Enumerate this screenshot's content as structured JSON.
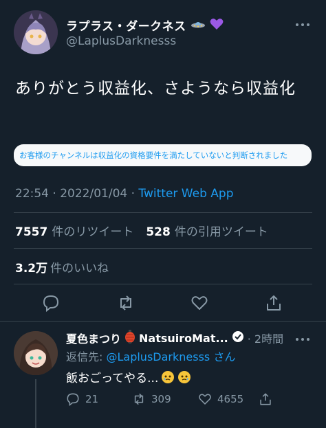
{
  "tweet": {
    "display_name": "ラプラス・ダークネス",
    "handle": "@LaplusDarknesss",
    "text": "ありがとう収益化、さようなら収益化",
    "quote_text": "お客様のチャンネルは収益化の資格要件を満たしていないと判断されました",
    "time": "22:54",
    "date": "2022/01/04",
    "dot": " · ",
    "app": "Twitter Web App",
    "retweet_count": "7557",
    "retweet_label": "件のリツイート",
    "quote_count": "528",
    "quote_label": "件の引用ツイート",
    "like_count": "3.2万",
    "like_label": "件のいいね",
    "name_badges": [
      "ufo-icon",
      "purple-heart-icon"
    ],
    "actions": [
      "reply-icon",
      "retweet-icon",
      "like-icon",
      "share-icon"
    ]
  },
  "reply": {
    "display_name": "夏色まつり",
    "name_rest": "NatsuiroMat...",
    "time": "· 2時間",
    "reply_to_prefix": "返信先: ",
    "reply_to_handle": "@LaplusDarknesss",
    "reply_to_suffix": " さん",
    "text": "飯おごってやる...",
    "reply_count": "21",
    "retweet_count": "309",
    "like_count": "4655"
  },
  "colors": {
    "background": "#15202b",
    "accent": "#1d9bf0",
    "secondary_text": "#8899a6",
    "divider": "#38444d"
  }
}
